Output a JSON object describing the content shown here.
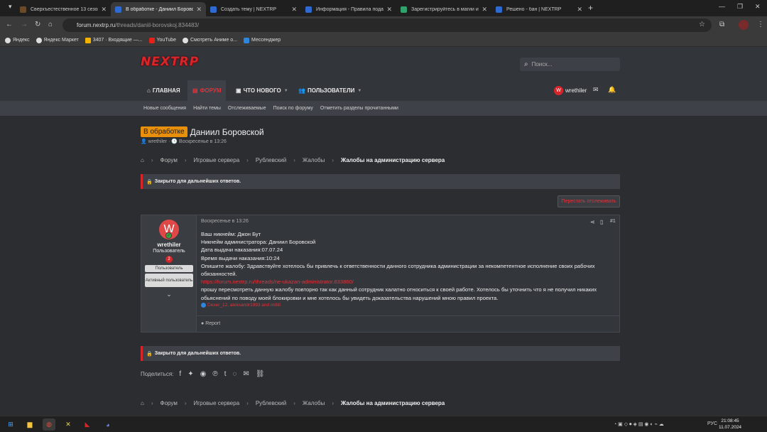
{
  "browser": {
    "tabs": [
      {
        "title": "Сверхъестественное 13 сезон",
        "color": "#6b4a2a"
      },
      {
        "title": "В обработке - Даниил Боровс",
        "color": "#2e6ad1",
        "active": true
      },
      {
        "title": "Создать тему | NEXTRP",
        "color": "#2e6ad1"
      },
      {
        "title": "Информация - Правила подач",
        "color": "#2e6ad1"
      },
      {
        "title": "Зарегистрируйтесь в магии и",
        "color": "#2fa36b"
      },
      {
        "title": "Решено - бан | NEXTRP",
        "color": "#2e6ad1"
      }
    ],
    "url_domain": "forum.nextrp.ru",
    "url_path": "/threads/daniil-borovskoj.834483/",
    "bookmarks": [
      {
        "label": "Яндекс",
        "color": "#ddd"
      },
      {
        "label": "Яндекс Маркет",
        "color": "#ddd"
      },
      {
        "label": "3407 · Входящие —...",
        "color": "#f5b300"
      },
      {
        "label": "YouTube",
        "color": "#e62117"
      },
      {
        "label": "Смотреть Аниме о...",
        "color": "#e0e0e0"
      },
      {
        "label": "Мессенджер",
        "color": "#2e86de"
      }
    ]
  },
  "site": {
    "logo": "NEXTRP",
    "search_placeholder": "Поиск...",
    "nav": {
      "home": "ГЛАВНАЯ",
      "forum": "ФОРУМ",
      "whats_new": "ЧТО НОВОГО",
      "users": "ПОЛЬЗОВАТЕЛИ"
    },
    "username": "wrethiler",
    "avatar_letter": "W",
    "subnav": [
      "Новые сообщения",
      "Найти темы",
      "Отслеживаемые",
      "Поиск по форуму",
      "Отметить разделы прочитанными"
    ]
  },
  "thread": {
    "status_badge": "В обработке",
    "title": "Даниил Боровской",
    "author": "wrethiler",
    "date": "Воскресенье в 13:26",
    "breadcrumb": [
      "Форум",
      "Игровые сервера",
      "Рублевский",
      "Жалобы",
      "Жалобы на администрацию сервера"
    ],
    "closed_notice": "Закрыто для дальнейших ответов.",
    "unwatch_label": "Перестать отслеживать"
  },
  "post": {
    "author": "wrethiler",
    "avatar_letter": "W",
    "role": "Пользователь",
    "rank_badge": "2",
    "banner_1": "Пользователь",
    "banner_2": "Активный пользователь",
    "date": "Воскресенье в 13:26",
    "number": "#1",
    "lines": [
      "Ваш никнейм: Джон Бут",
      "Никнейм администратора: Даниил Боровской",
      "Дата выдачи наказания:07.07.24",
      "Время выдачи наказания:10:24",
      "Опишите жалобу: Здравствуйте хотелось бы привлечь к ответственности данного сотрудника администрации за некомпетентное исполнение своих рабочих обязанностей."
    ],
    "link": "https://forum.nextrp.ru/threads/ne-ukazan-administrator.833860/",
    "after_link": "прошу пересмотреть данную жалобу повторно так как данный сотрудник халатно относиться к своей работе. Хотелось бы уточнить что я не получил никаких обьяснений по поводу моей блокировки и мне хотелось бы увидеть доказательства нарушений мною правил проекта.",
    "likes": "Dexer_12, aleksandr1993 and millili",
    "report": "Report"
  },
  "share_label": "Поделиться:",
  "taskbar": {
    "lang": "РУС",
    "time": "21:08:45",
    "date": "11.07.2024"
  }
}
